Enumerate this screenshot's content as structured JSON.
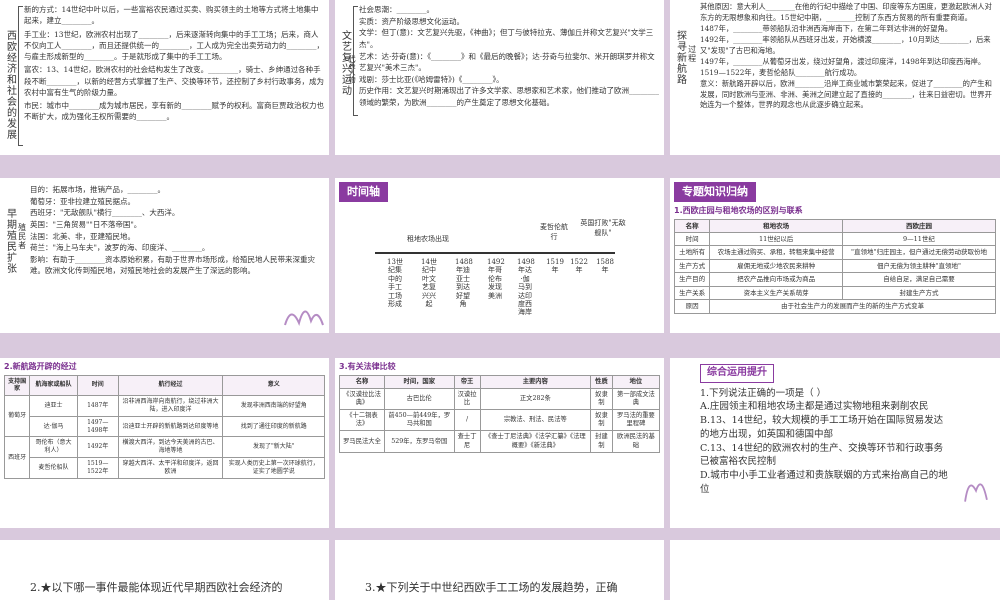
{
  "slides": {
    "s1": {
      "label": "西欧经济和社会的发展",
      "sub1": "农业领域",
      "sub2": "西欧庄园和农民阶层",
      "lines": [
        "新的方式：14世纪中叶以后，一些富裕农民通过买卖、购买领主的土地等方式将土地集中起来，建立________。",
        "手工业：13世纪，欧洲农村出现了________，后来逐渐转向集中的手工工场；后来，商人不仅向工人________，而且还提供统一的________，工人成为完全出卖劳动力的________，与雇主形成新型的________。于是就形成了集中的手工工场。",
        "富农：13、14世纪，欧洲农村的社会结构发生了改变。________，骑士、乡绅通过各种手段不断________，以新的经营方式掌握了生产、交换等环节，还控制了乡村行政事务，成为农村中富有生气的阶级力量。",
        "市民：城市中________成为城市居民，享有新的________赋予的权利。富商巨贾政治权力也不断扩大，成为强化王权所需要的________。"
      ]
    },
    "s2": {
      "label": "文艺复兴运动",
      "lines": [
        "社会思潮：________。",
        "实质：资产阶级思想文化运动。",
        "代表人物",
        "文学：但丁(意)：文艺复兴先驱，《神曲》；但丁与彼特拉克、薄伽丘并称文艺复兴\"文学三杰\"。",
        "艺术：达·芬奇(意)：《________》和《最后的晚餐》；达·芬奇与拉斐尔、米开朗琪罗并称文艺复兴\"美术三杰\"。",
        "戏剧：莎士比亚(《哈姆雷特》)《________》。",
        "历史作用：文艺复兴时期涌现出了许多文学家、思想家和艺术家，他们推动了欧洲________领域的繁荣，为欧洲________的产生奠定了思想文化基础。"
      ]
    },
    "s3": {
      "label1": "探寻新航路",
      "label2": "过程",
      "lines": [
        "其他原因：意大利人________在他的行纪中描绘了中国、印度等东方国度，更激起欧洲人对东方的无限想象和向往。15世纪中期，________控制了东西方贸易的所有重要商道。",
        "1487年，________带领船队沿非洲西海岸南下，在第二年到达非洲的好望角。",
        "1492年，________率领船队从西班牙出发，开始横渡________，10月到达________，后来又\"发现\"了古巴和海地。",
        "1497年，________从葡萄牙出发，绕过好望角，渡过印度洋，1498年到达印度西海岸。",
        "1519—1522年，麦哲伦船队________航行成功。",
        "意义：新航路开辟以后，欧洲________沿岸工商业城市繁荣起来，促进了________的产生和发展，同时欧洲与亚洲、非洲、美洲之间建立起了直接的________，往来日益密切。世界开始连为一个整体，世界的观念也从此逐步确立起来。"
      ]
    },
    "s4": {
      "label1": "早期殖民扩张",
      "label2": "殖民者",
      "lines": [
        "目的：拓展市场，推销产品，________。",
        "葡萄牙：亚非拉建立殖民据点。",
        "西班牙：\"无敌舰队\"横行________、大西洋。",
        "英国：\"三角贸易\"\"日不落帝国\"。",
        "法国：北美、非，亚建殖民地。",
        "荷兰：\"海上马车夫\"，波罗的海、印度洋、________。",
        "影响：有助于________资本原始积累，有助于世界市场形成，给殖民地人民带来深重灾难。欧洲文化传到殖民地，对殖民地社会的发展产生了深远的影响。"
      ]
    },
    "s5": {
      "title": "时间轴",
      "top_labels": [
        "租地农场出现",
        "麦哲伦航行",
        "英国打败\"无敌舰队\""
      ],
      "points": [
        "13世纪集中的手工工场形成",
        "14世纪中叶文艺复兴兴起",
        "1488年迪亚士到达好望角",
        "1492年哥伦布发现美洲",
        "1498年达·伽马到达印度西海岸",
        "1519年",
        "1522年",
        "1588年"
      ]
    },
    "s6": {
      "title": "专题知识归纳",
      "subtitle": "1.西欧庄园与租地农场的区别与联系",
      "headers": [
        "名称",
        "租地农场",
        "西欧庄园"
      ],
      "rows": [
        [
          "时间",
          "11世纪以后",
          "9—11世纪"
        ],
        [
          "土地所有",
          "农场主通过购买、承租，转租来集中经营",
          "\"直领地\"归庄园主，但户通过无偿劳动获取份地"
        ],
        [
          "生产方式",
          "雇佣无地或少地农民来耕种",
          "佃户无偿为领主耕种\"直领地\""
        ],
        [
          "生产目的",
          "把农产品推向市场或为商品",
          "自给自足，满足自己需要"
        ],
        [
          "生产关系",
          "资本主义生产关系萌芽",
          "封建生产方式"
        ],
        [
          "原因",
          "由于社会生产力的发展而产生的新的生产方式变革",
          ""
        ]
      ]
    },
    "s7": {
      "subtitle": "2.新航路开辟的经过",
      "headers": [
        "支持国家",
        "航海家或船队",
        "时间",
        "航行经过",
        "意义"
      ],
      "rows": [
        [
          "葡萄牙",
          "迪亚士",
          "1487年",
          "沿非洲西海岸向南航行，绕过非洲大陆，进入印度洋",
          "发现非洲西南端的好望角"
        ],
        [
          "",
          "达·伽马",
          "1497—1498年",
          "沿迪亚士开辟的新航路到达印度等地",
          "找到了通往印度的新航路"
        ],
        [
          "西班牙",
          "哥伦布（意大利人）",
          "1492年",
          "横渡大西洋，到达今天美洲的古巴、海地等地",
          "发现了\"新大陆\""
        ],
        [
          "",
          "麦哲伦船队",
          "1519—1522年",
          "穿越大西洋、太平洋和印度洋，返回欧洲",
          "实现人类历史上第一次环球航行，证实了地圆学说"
        ]
      ]
    },
    "s8": {
      "subtitle": "3.有关法律比较",
      "headers": [
        "名称",
        "时间，国家",
        "帝王",
        "主要内容",
        "性质",
        "地位"
      ],
      "rows": [
        [
          "《汉谟拉比法典》",
          "古巴比伦",
          "汉谟拉比",
          "正文282条",
          "奴隶制",
          "第一部成文法典"
        ],
        [
          "《十二铜表法》",
          "前450—前449年，罗马共和国",
          "/",
          "宗教法、刑法、民法等",
          "奴隶制",
          "罗马法的重要里程碑"
        ],
        [
          "罗马民法大全",
          "529年，东罗马帝国",
          "查士丁尼",
          "《查士丁尼法典》《法学汇纂》《法理概要》《新法典》",
          "封建制",
          "欧洲民法的基础"
        ]
      ]
    },
    "s9": {
      "title": "综合运用提升",
      "question": "1.下列说法正确的一项是（    ）",
      "options": [
        "A.庄园领主和租地农场主都是通过实物地租来剥削农民",
        "B.13、14世纪，较大规模的手工工场开始在国际贸易发达的地方出现，如英国和德国中部",
        "C.13、14世纪的欧洲农村的生产、交换等环节和行政事务已被富裕农民控制",
        "D.城市中小手工业者通过和贵族联姻的方式来抬高自己的地位"
      ]
    },
    "s10": {
      "text": "2.★以下哪一事件最能体现近代早期西欧社会经济的"
    },
    "s11": {
      "text": "3.★下列关于中世纪西欧手工工场的发展趋势，正确"
    }
  },
  "colors": {
    "accent": "#8a3ba0",
    "background": "#d9c9dd"
  }
}
